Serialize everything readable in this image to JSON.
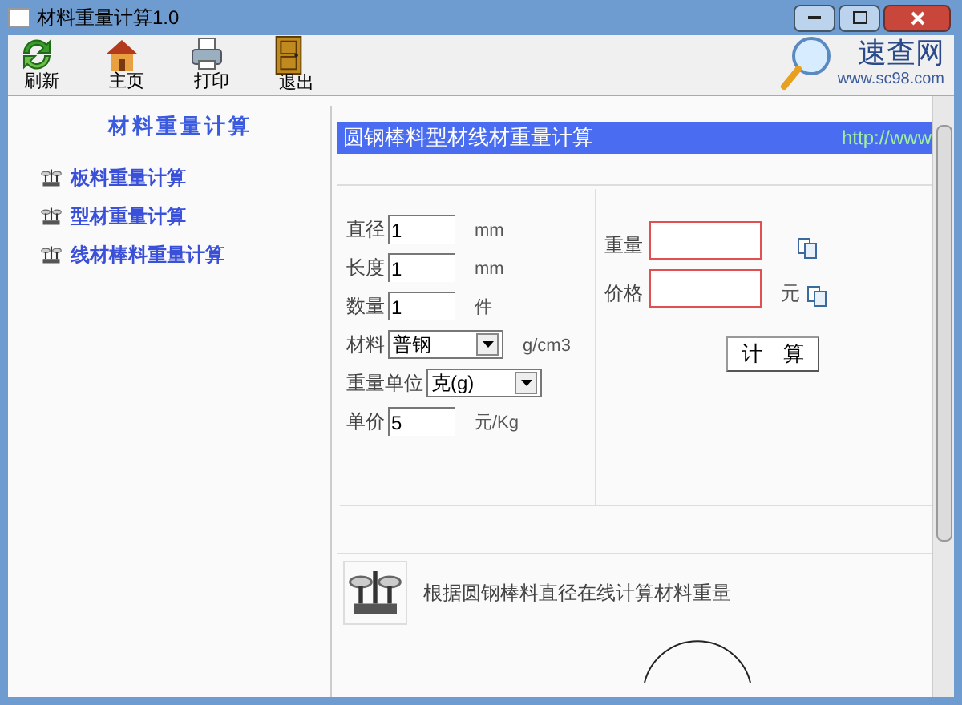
{
  "window": {
    "title": "材料重量计算1.0"
  },
  "toolbar": [
    {
      "kind": "refresh",
      "label": "刷新"
    },
    {
      "kind": "home",
      "label": "主页"
    },
    {
      "kind": "print",
      "label": "打印"
    },
    {
      "kind": "exit",
      "label": "退出"
    }
  ],
  "logo": {
    "name": "速查网",
    "url": "www.sc98.com"
  },
  "sidebar": {
    "title": "材料重量计算",
    "items": [
      {
        "label": "板料重量计算"
      },
      {
        "label": "型材重量计算"
      },
      {
        "label": "线材棒料重量计算"
      }
    ]
  },
  "header": {
    "title": "圆钢棒料型材线材重量计算",
    "url": "http://www"
  },
  "inputs": [
    {
      "kind": "input",
      "label": "直径",
      "value": "1",
      "unit": "mm"
    },
    {
      "kind": "input",
      "label": "长度",
      "value": "1",
      "unit": "mm"
    },
    {
      "kind": "input",
      "label": "数量",
      "value": "1",
      "unit": "件"
    },
    {
      "kind": "select",
      "label": "材料",
      "value": "普钢",
      "unit": "g/cm3"
    },
    {
      "kind": "select",
      "label": "重量单位",
      "value": "克(g)"
    },
    {
      "kind": "input",
      "label": "单价",
      "value": "5",
      "unit": "元/Kg"
    }
  ],
  "outputs": [
    {
      "label": "重量"
    },
    {
      "label": "价格",
      "unit": "元"
    }
  ],
  "calc_button": "计　算",
  "description": "根据圆钢棒料直径在线计算材料重量"
}
